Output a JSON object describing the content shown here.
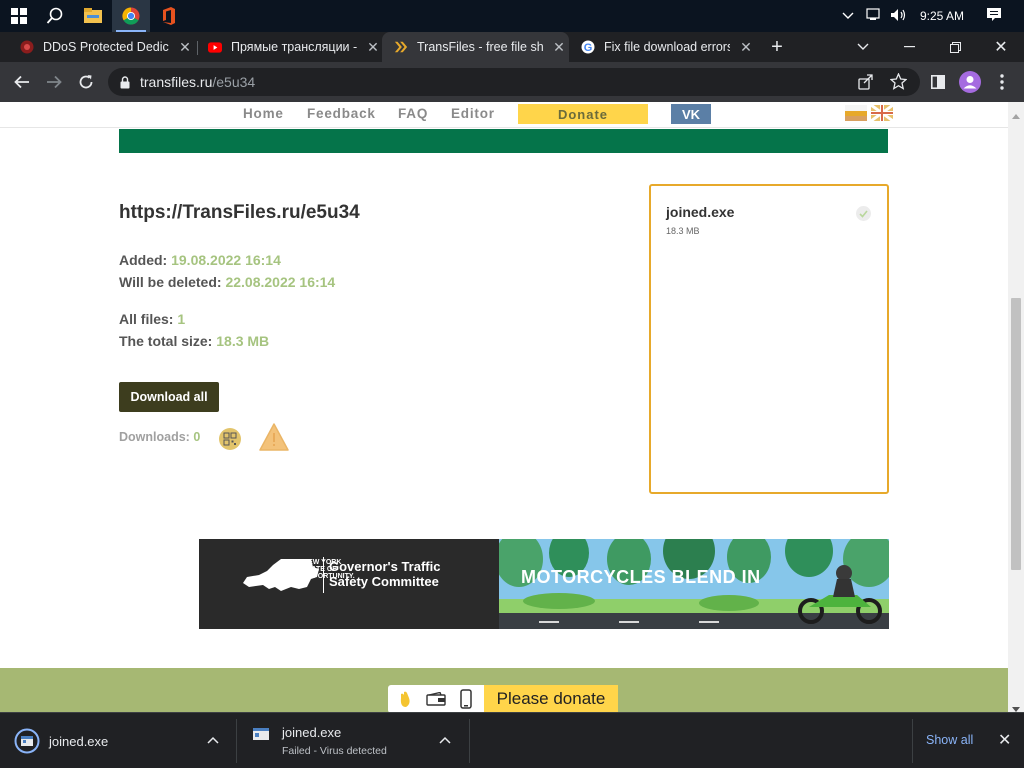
{
  "taskbar": {
    "apps": [
      {
        "name": "windows-start",
        "icon": "windows-logo-icon"
      },
      {
        "name": "search",
        "icon": "search-icon"
      },
      {
        "name": "file-explorer",
        "icon": "folder-icon"
      },
      {
        "name": "chrome",
        "icon": "chrome-icon",
        "active": true
      },
      {
        "name": "office",
        "icon": "office-icon"
      }
    ],
    "tray": {
      "time": "9:25 AM"
    }
  },
  "tabs": [
    {
      "title": "DDoS Protected Dedica",
      "icon": "ddos-favicon-icon"
    },
    {
      "title": "Прямые трансляции -",
      "icon": "youtube-favicon-icon"
    },
    {
      "title": "TransFiles - free file sha",
      "icon": "transfiles-favicon-icon",
      "active": true
    },
    {
      "title": "Fix file download errors",
      "icon": "google-favicon-icon"
    }
  ],
  "address_bar": {
    "domain": "transfiles.ru",
    "path": "/e5u34"
  },
  "page": {
    "nav": {
      "home": "Home",
      "feedback": "Feedback",
      "faq": "FAQ",
      "editor": "Editor",
      "donate": "Donate",
      "vk": "VK"
    },
    "file_url": "https://TransFiles.ru/e5u34",
    "added_label": "Added:",
    "added_value": "19.08.2022 16:14",
    "deleted_label": "Will be deleted:",
    "deleted_value": "22.08.2022 16:14",
    "all_files_label": "All files:",
    "all_files_value": "1",
    "total_size_label": "The total size:",
    "total_size_value": "18.3 MB",
    "download_all": "Download all",
    "downloads_label": "Downloads:",
    "downloads_value": "0",
    "file_card": {
      "name": "joined.exe",
      "size": "18.3 MB"
    },
    "banner": {
      "org_line1": "Governor's Traffic",
      "org_line2": "Safety Committee",
      "state_line1": "NEW YORK",
      "state_line2": "STATE OF",
      "state_line3": "OPPORTUNITY.",
      "headline": "MOTORCYCLES BLEND IN"
    },
    "footer": {
      "please_donate": "Please donate"
    }
  },
  "download_shelf": {
    "items": [
      {
        "name": "joined.exe",
        "status": ""
      },
      {
        "name": "joined.exe",
        "status": "Failed - Virus detected"
      }
    ],
    "show_all": "Show all"
  },
  "colors": {
    "green_band": "#05744a",
    "accent_value": "#a6c480",
    "donate_yellow": "#ffd54a",
    "file_border": "#e7a92b",
    "footer_olive": "#a6b873"
  }
}
